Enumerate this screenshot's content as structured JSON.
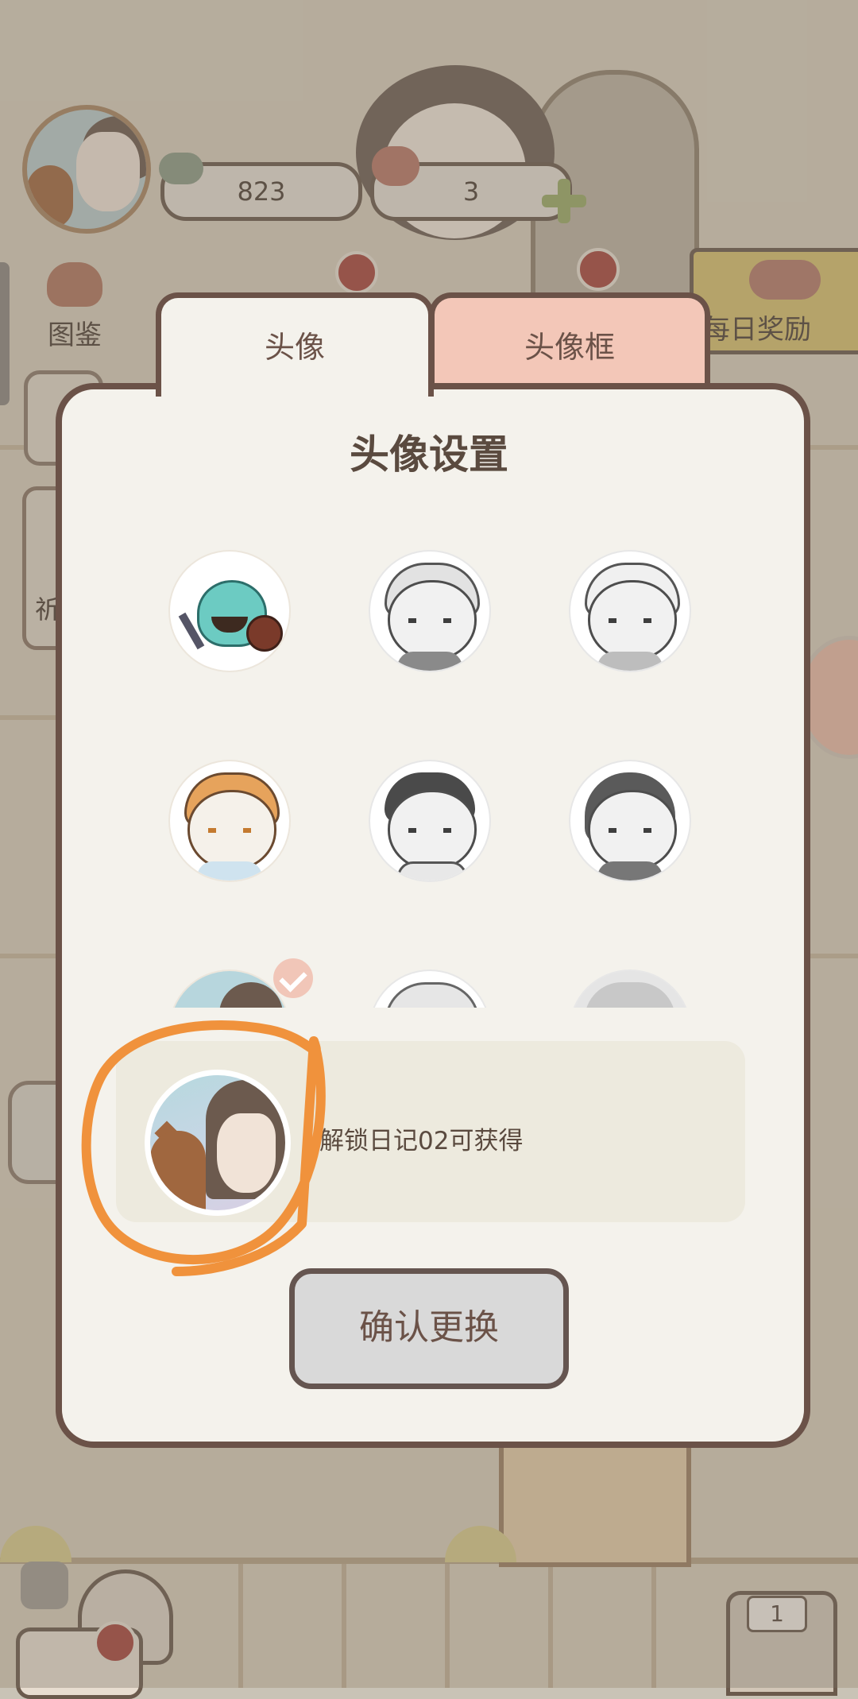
{
  "hud": {
    "fish_count": "823",
    "heart_count": "3"
  },
  "menu": {
    "left_label": "图鉴",
    "side_label": "祈",
    "daily_reward": "每日奖励"
  },
  "tabs": [
    {
      "label": "头像",
      "active": true
    },
    {
      "label": "头像框",
      "active": false
    }
  ],
  "modal": {
    "title": "头像设置",
    "avatars": [
      {
        "name": "slime-avatar",
        "locked": false
      },
      {
        "name": "boy-wavy-hair-avatar",
        "locked": true
      },
      {
        "name": "boy-worried-avatar",
        "locked": true
      },
      {
        "name": "orange-hair-boy-avatar",
        "locked": false
      },
      {
        "name": "dark-hair-boy-avatar",
        "locked": true
      },
      {
        "name": "girl-bob-avatar",
        "locked": true
      },
      {
        "name": "girl-cat-avatar",
        "locked": false,
        "selected": true
      },
      {
        "name": "gray-avatar-1",
        "locked": true
      },
      {
        "name": "gray-avatar-2",
        "locked": true
      }
    ],
    "unlock_hint": "解锁日记02可获得",
    "confirm_label": "确认更换"
  },
  "fridge_badge": "1",
  "colors": {
    "border": "#6b5248",
    "active_tab": "#f4f2ec",
    "inactive_tab": "#f3c7b8",
    "annotation": "#f0923c"
  }
}
